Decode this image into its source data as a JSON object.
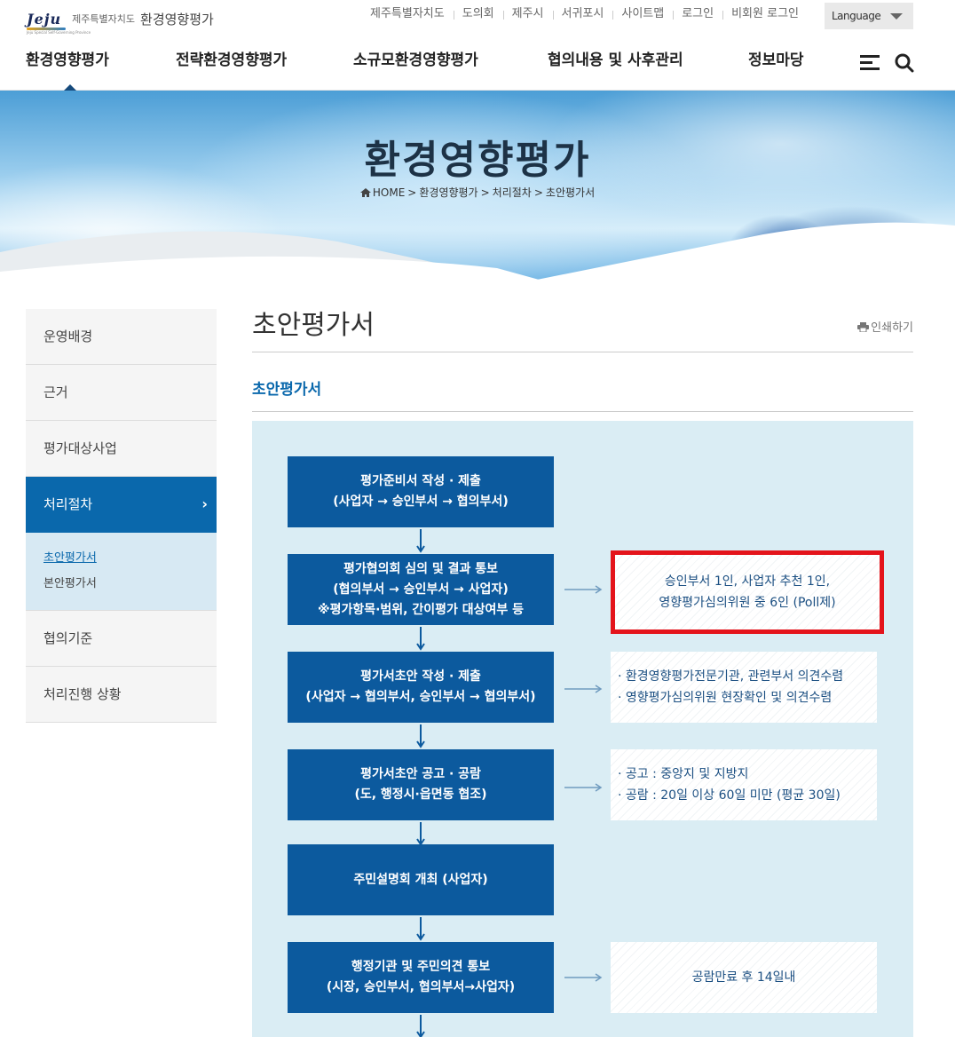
{
  "header": {
    "logo_mark": "Jeju",
    "logo_sub": "Jeju Special Self-Governing Province",
    "logo_region": "제주특별자치도",
    "logo_name": "환경영향평가",
    "util_links": [
      "제주특별자치도",
      "도의회",
      "제주시",
      "서귀포시",
      "사이트맵",
      "로그인",
      "비회원 로그인"
    ],
    "language_label": "Language",
    "gnb": [
      "환경영향평가",
      "전략환경영향평가",
      "소규모환경영향평가",
      "협의내용 및 사후관리",
      "정보마당"
    ]
  },
  "banner": {
    "title": "환경영향평가",
    "breadcrumb": [
      "HOME",
      "환경영향평가",
      "처리절차",
      "초안평가서"
    ]
  },
  "sidebar": {
    "items": [
      "운영배경",
      "근거",
      "평가대상사업",
      "처리절차",
      "협의기준",
      "처리진행 상황"
    ],
    "active_chevron": "›",
    "sub_items": [
      "초안평가서",
      "본안평가서"
    ]
  },
  "content": {
    "page_title": "초안평가서",
    "print_label": "인쇄하기",
    "section_title": "초안평가서",
    "steps": [
      [
        "평가준비서 작성 · 제출",
        "(사업자 → 승인부서 → 협의부서)"
      ],
      [
        "평가협의회 심의 및 결과 통보",
        "(협의부서 → 승인부서 → 사업자)",
        "※평가항목·범위, 간이평가 대상여부 등"
      ],
      [
        "평가서초안 작성 · 제출",
        "(사업자 → 협의부서, 승인부서 → 협의부서)"
      ],
      [
        "평가서초안 공고 · 공람",
        "(도, 행정시·읍면동 협조)"
      ],
      [
        "주민설명회 개최 (사업자)"
      ],
      [
        "행정기관 및 주민의견 통보",
        "(시장, 승인부서, 협의부서→사업자)"
      ]
    ],
    "notes": {
      "n2": [
        "승인부서 1인, 사업자 추천 1인,",
        "영향평가심의위원 중 6인 (Poll제)"
      ],
      "n3": [
        "· 환경영향평가전문기관, 관련부서 의견수렴",
        "· 영향평가심의위원 현장확인 및 의견수렴"
      ],
      "n4": [
        "· 공고 : 중앙지 및 지방지",
        "· 공람 : 20일 이상 60일 미만 (평균 30일)"
      ],
      "n6": [
        "공람만료 후 14일내"
      ]
    }
  },
  "colors": {
    "primary": "#0a68ac",
    "step_bg": "#0c5a9e",
    "highlight": "#e4141b",
    "flow_bg": "#daedf4"
  }
}
